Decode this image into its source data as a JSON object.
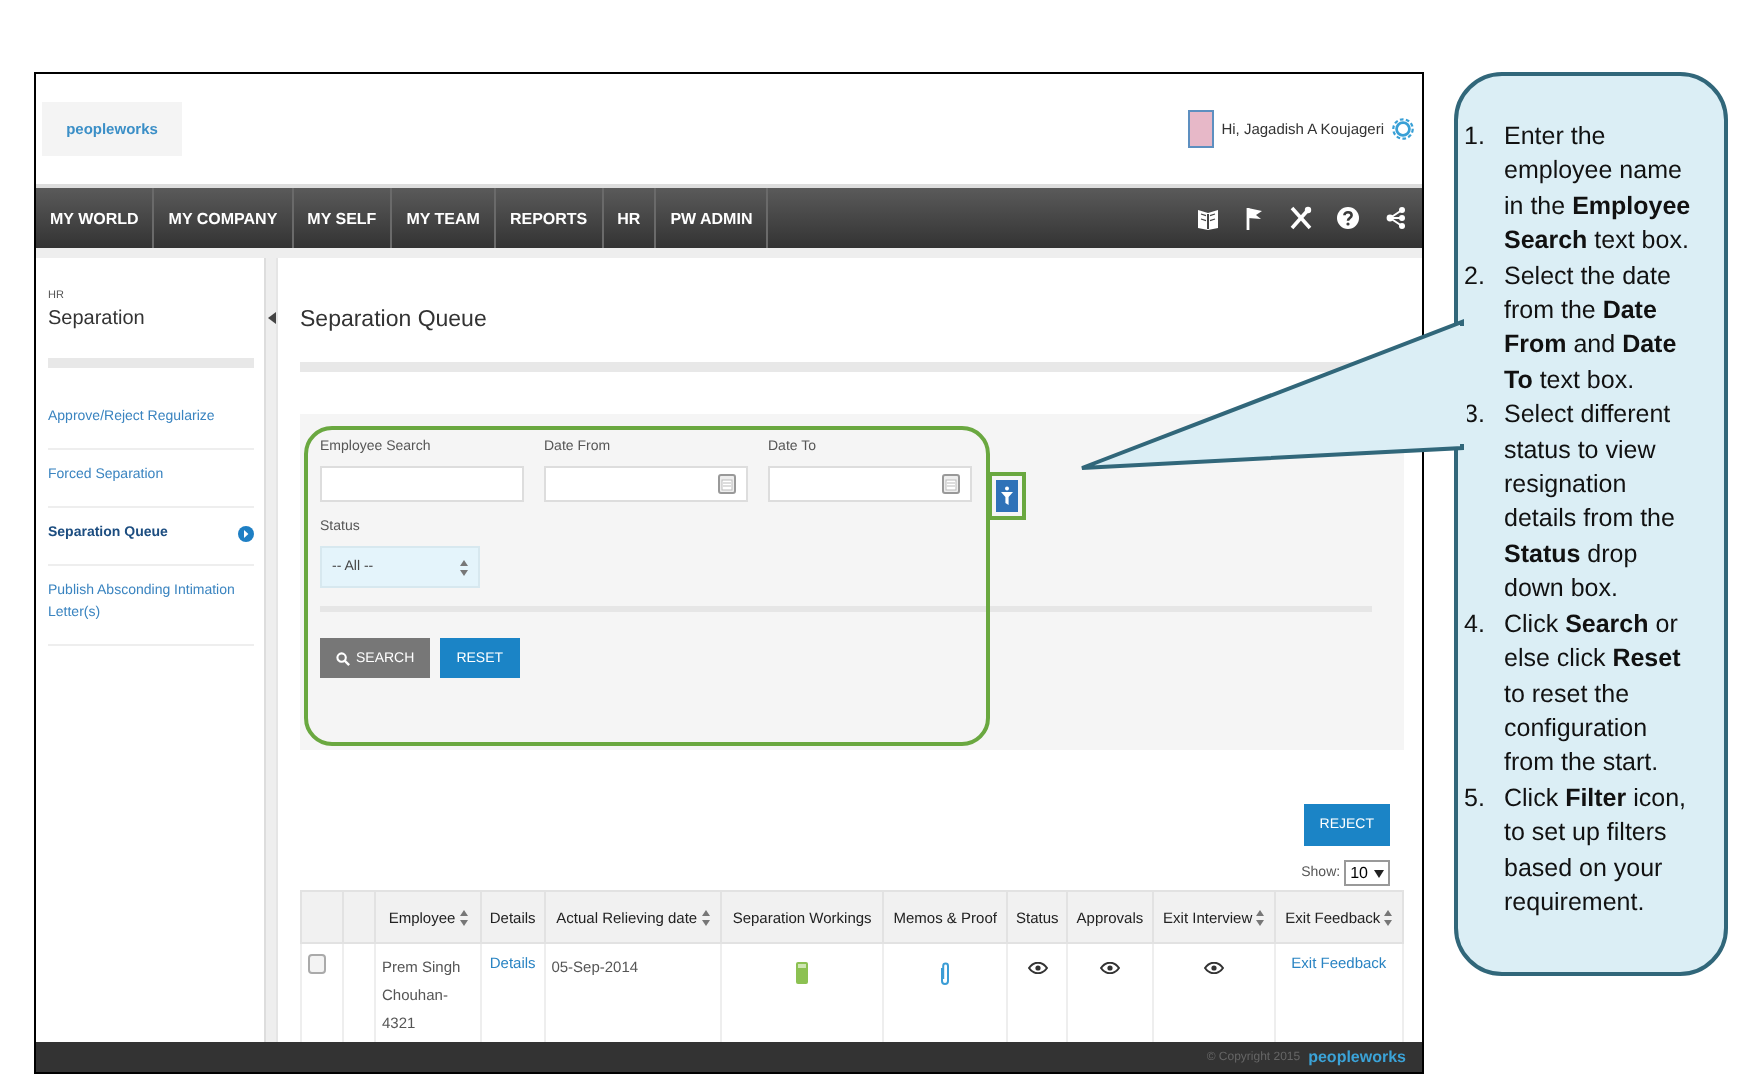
{
  "header": {
    "logo": "peopleworks",
    "greeting": "Hi, Jagadish A Koujageri"
  },
  "nav": {
    "items": [
      "MY WORLD",
      "MY COMPANY",
      "MY SELF",
      "MY TEAM",
      "REPORTS",
      "HR",
      "PW ADMIN"
    ]
  },
  "sidebar": {
    "section": "HR",
    "title": "Separation",
    "items": [
      {
        "label": "Approve/Reject Regularize",
        "selected": false
      },
      {
        "label": "Forced Separation",
        "selected": false
      },
      {
        "label": "Separation Queue",
        "selected": true
      },
      {
        "label": "Publish Absconding Intimation Letter(s)",
        "selected": false
      }
    ]
  },
  "page": {
    "title": "Separation Queue"
  },
  "filters": {
    "fields": [
      {
        "label": "Employee Search",
        "kind": "text"
      },
      {
        "label": "Date From",
        "kind": "date"
      },
      {
        "label": "Date To",
        "kind": "date"
      }
    ],
    "status": {
      "label": "Status",
      "value": "-- All --"
    },
    "buttons": [
      {
        "label": "SEARCH",
        "kind": "search"
      },
      {
        "label": "RESET",
        "kind": "reset"
      }
    ]
  },
  "table": {
    "action": "REJECT",
    "show_label": "Show:",
    "show_value": "10",
    "columns": [
      {
        "label": "Employee",
        "sortable": true
      },
      {
        "label": "Details",
        "sortable": false
      },
      {
        "label": "Actual Relieving date",
        "sortable": true
      },
      {
        "label": "Separation Workings",
        "sortable": false
      },
      {
        "label": "Memos & Proof",
        "sortable": false
      },
      {
        "label": "Status",
        "sortable": false
      },
      {
        "label": "Approvals",
        "sortable": false
      },
      {
        "label": "Exit Interview",
        "sortable": true
      },
      {
        "label": "Exit Feedback",
        "sortable": true
      }
    ],
    "rows": [
      {
        "checked": false,
        "cells": [
          {
            "kind": "text",
            "text": "Prem Singh Chouhan-4321"
          },
          {
            "kind": "link",
            "text": "Details"
          },
          {
            "kind": "text",
            "text": "05-Sep-2014"
          },
          {
            "kind": "workings"
          },
          {
            "kind": "attachment"
          },
          {
            "kind": "view"
          },
          {
            "kind": "view"
          },
          {
            "kind": "view"
          },
          {
            "kind": "link",
            "text": "Exit Feedback"
          }
        ]
      }
    ]
  },
  "footer": {
    "copyright": "© Copyright 2015",
    "logo": "peopleworks"
  },
  "callout": {
    "steps": [
      {
        "number": "1.",
        "text": "Enter the employee name in the **Employee Search** text box."
      },
      {
        "number": "2.",
        "text": "Select the date from the **Date From** and **Date To** text box."
      },
      {
        "number": "3.",
        "text": "Select different status to view resignation details from the **Status** drop down box."
      },
      {
        "number": "4.",
        "text": "Click **Search** or else click **Reset** to reset the configuration from the start."
      },
      {
        "number": "5.",
        "text": "Click **Filter** icon, to set up filters based on your requirement."
      }
    ]
  }
}
